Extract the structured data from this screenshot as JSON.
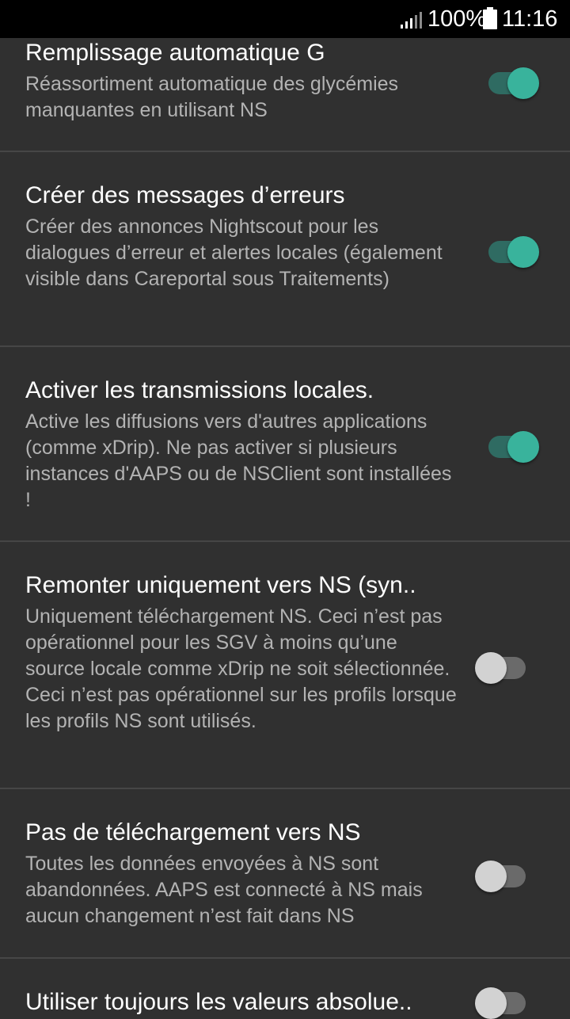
{
  "status_bar": {
    "battery_percent": "100%",
    "time": "11:16",
    "icons": [
      "signal-icon",
      "battery-icon"
    ]
  },
  "colors": {
    "background": "#303030",
    "switch_on_thumb": "#39b39c",
    "switch_on_track": "#2f6b62",
    "switch_off_thumb": "#d2d2d2",
    "switch_off_track": "#6a6a6a"
  },
  "preferences": [
    {
      "title": "Remplissage automatique G",
      "summary": "Réassortiment automatique des glycémies manquantes en utilisant NS",
      "enabled": true
    },
    {
      "title": "Créer des messages d’erreurs",
      "summary": "Créer des annonces Nightscout pour les dialogues d’erreur et alertes locales (également visible dans Careportal sous Traitements)",
      "enabled": true
    },
    {
      "title": "Activer les transmissions locales.",
      "summary": "Active les diffusions vers d'autres applications (comme xDrip). Ne pas activer si plusieurs instances d'AAPS ou de NSClient sont installées !",
      "enabled": true
    },
    {
      "title": "Remonter uniquement vers NS (syn..",
      "summary": "Uniquement téléchargement NS. Ceci n’est pas opérationnel pour les SGV à moins qu’une source locale comme xDrip ne soit sélectionnée. Ceci n’est pas opérationnel sur les profils lorsque les profils NS sont utilisés.",
      "enabled": false
    },
    {
      "title": "Pas de téléchargement vers NS",
      "summary": "Toutes les données envoyées à NS sont abandonnées. AAPS est connecté à NS mais aucun changement n’est fait dans NS",
      "enabled": false
    },
    {
      "title": "Utiliser toujours les valeurs absolue..",
      "summary": "",
      "enabled": false
    }
  ]
}
